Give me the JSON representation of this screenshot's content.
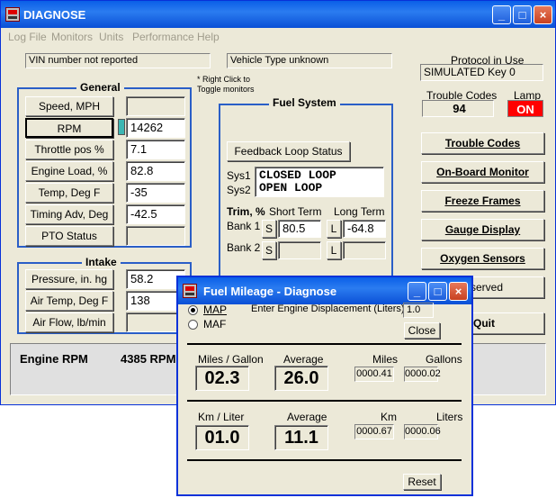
{
  "main_window": {
    "title": "DIAGNOSE",
    "menu": [
      "Log File",
      "Monitors",
      "Units",
      "Performance",
      "Help"
    ],
    "vin": "VIN number not reported",
    "vehicle_type": "Vehicle Type unknown",
    "right_click_hint": "* Right Click to Toggle monitors",
    "protocol_label": "Protocol in Use",
    "protocol_value": "SIMULATED Key 0",
    "trouble_codes_label": "Trouble Codes",
    "trouble_codes_value": "94",
    "lamp_label": "Lamp",
    "lamp_value": "ON",
    "lamp_color": "#ff0000",
    "general": {
      "title": "General",
      "rows": [
        {
          "label": "Speed, MPH",
          "value": ""
        },
        {
          "label": "RPM",
          "value": "14262"
        },
        {
          "label": "Throttle pos %",
          "value": "7.1"
        },
        {
          "label": "Engine Load, %",
          "value": "82.8"
        },
        {
          "label": "Temp, Deg F",
          "value": "-35"
        },
        {
          "label": "Timing Adv, Deg",
          "value": "-42.5"
        },
        {
          "label": "PTO Status",
          "value": ""
        }
      ]
    },
    "intake": {
      "title": "Intake",
      "rows": [
        {
          "label": "Pressure, in. hg",
          "value": "58.2"
        },
        {
          "label": "Air Temp, Deg F",
          "value": "138"
        },
        {
          "label": "Air Flow, lb/min",
          "value": ""
        }
      ]
    },
    "fuel_system": {
      "title": "Fuel System",
      "feedback_button": "Feedback Loop Status",
      "sys1_label": "Sys1",
      "sys2_label": "Sys2",
      "sys1_value": "CLOSED LOOP",
      "sys2_value": "OPEN LOOP",
      "trim_label": "Trim, %",
      "short_term_label": "Short Term",
      "long_term_label": "Long Term",
      "bank1_label": "Bank 1",
      "bank2_label": "Bank 2",
      "s_label": "S",
      "l_label": "L",
      "bank1_short": "80.5",
      "bank1_long": "-64.8",
      "bank2_short": "",
      "bank2_long": ""
    },
    "buttons": [
      "Trouble Codes",
      "On-Board Monitor",
      "Freeze Frames",
      "Gauge Display",
      "Oxygen Sensors"
    ],
    "reserved_text": "served",
    "quit_label": "Quit",
    "status_label": "Engine RPM",
    "status_value": "4385 RPM"
  },
  "fuel_window": {
    "title": "Fuel Mileage - Diagnose",
    "radio_map": "MAP",
    "radio_maf": "MAF",
    "radio_selected": "MAP",
    "displacement_label": "Enter Engine Displacement (Liters)",
    "displacement_value": "1.0",
    "close_label": "Close",
    "mpg_label": "Miles / Gallon",
    "mpg_value": "02.3",
    "avg_label": "Average",
    "mpg_avg_value": "26.0",
    "miles_label": "Miles",
    "miles_value": "0000.41",
    "gallons_label": "Gallons",
    "gallons_value": "0000.02",
    "kpl_label": "Km /  Liter",
    "kpl_value": "01.0",
    "kpl_avg_value": "11.1",
    "km_label": "Km",
    "km_value": "0000.67",
    "liters_label": "Liters",
    "liters_value": "0000.06",
    "reset_label": "Reset"
  }
}
